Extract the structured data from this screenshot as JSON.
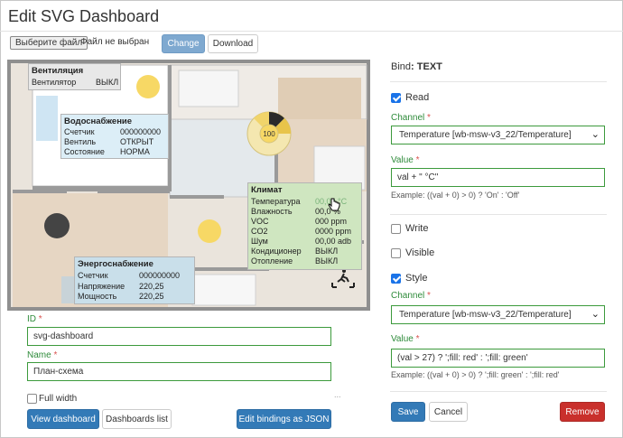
{
  "title": "Edit SVG Dashboard",
  "file": {
    "choose_label": "Выберите файл",
    "no_file": "Файл не выбран"
  },
  "toolbar": {
    "change": "Change",
    "download": "Download"
  },
  "plan": {
    "ventilation": {
      "title": "Вентиляция",
      "rows": [
        {
          "name": "Вентилятор",
          "value": "ВЫКЛ"
        }
      ]
    },
    "water": {
      "title": "Водоснабжение",
      "rows": [
        {
          "name": "Счетчик",
          "value": "000000000"
        },
        {
          "name": "Вентиль",
          "value": "ОТКРЫТ"
        },
        {
          "name": "Состояние",
          "value": "НОРМА"
        }
      ]
    },
    "climate": {
      "title": "Климат",
      "rows": [
        {
          "name": "Температура",
          "value": "00,00 °C"
        },
        {
          "name": "Влажность",
          "value": "00,0 %"
        },
        {
          "name": "VOC",
          "value": "000 ppm"
        },
        {
          "name": "CO2",
          "value": "0000 ppm"
        },
        {
          "name": "Шум",
          "value": "00,00 adb"
        },
        {
          "name": "Кондиционер",
          "value": "ВЫКЛ"
        },
        {
          "name": "Отопление",
          "value": "ВЫКЛ"
        }
      ]
    },
    "energy": {
      "title": "Энергоснабжение",
      "rows": [
        {
          "name": "Счетчик",
          "value": "000000000"
        },
        {
          "name": "Напряжение",
          "value": "220,25"
        },
        {
          "name": "Мощность",
          "value": "220,25"
        }
      ]
    },
    "dimmer_value": "100",
    "colors": {
      "lamp_on": "#f7d865",
      "lamp_off": "#444444",
      "climate_bg": "#cfe6c0",
      "water_bg": "#dceef7"
    }
  },
  "form": {
    "id_label": "ID",
    "id_value": "svg-dashboard",
    "name_label": "Name",
    "name_value": "План-схема",
    "full_width": "Full width",
    "view_dashboard": "View dashboard",
    "dashboards_list": "Dashboards list",
    "edit_bindings": "Edit bindings as JSON",
    "dots": "..."
  },
  "bind": {
    "header_prefix": "Bind",
    "header_value": "TEXT",
    "read": {
      "label": "Read",
      "checked": true
    },
    "channel_label": "Channel",
    "channel_value": "Temperature [wb-msw-v3_22/Temperature]",
    "value_label": "Value",
    "value_value": "val + \" °C\"",
    "example1": "Example: ((val + 0) > 0) ? 'On' : 'Off'",
    "write": {
      "label": "Write",
      "checked": false
    },
    "visible": {
      "label": "Visible",
      "checked": false
    },
    "style": {
      "label": "Style",
      "checked": true
    },
    "style_channel_value": "Temperature [wb-msw-v3_22/Temperature]",
    "style_value_value": "(val  > 27) ? ';fill: red' : ';fill: green'",
    "example2": "Example: ((val + 0) > 0) ? ';fill: green' : ';fill: red'",
    "save": "Save",
    "cancel": "Cancel",
    "remove": "Remove"
  },
  "accent": "#337ab7",
  "danger": "#c9302c",
  "valid": "#3c9a3c"
}
